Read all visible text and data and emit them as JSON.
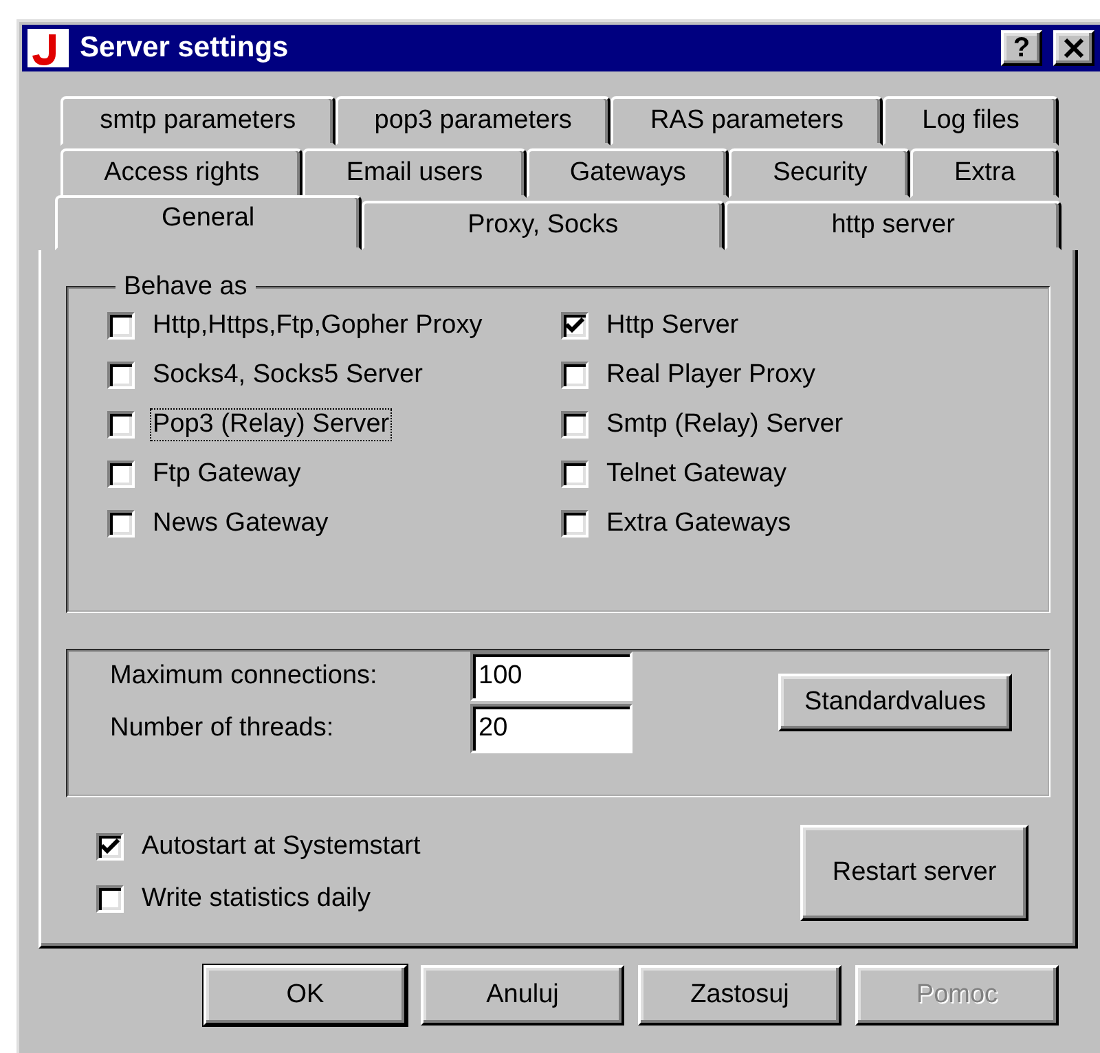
{
  "window": {
    "title": "Server settings",
    "help_button": "?"
  },
  "tab_rows": [
    [
      {
        "label": "smtp parameters",
        "selected": false
      },
      {
        "label": "pop3 parameters",
        "selected": false
      },
      {
        "label": "RAS parameters",
        "selected": false
      },
      {
        "label": "Log files",
        "selected": false
      }
    ],
    [
      {
        "label": "Access rights",
        "selected": false
      },
      {
        "label": "Email users",
        "selected": false
      },
      {
        "label": "Gateways",
        "selected": false
      },
      {
        "label": "Security",
        "selected": false
      },
      {
        "label": "Extra",
        "selected": false
      }
    ],
    [
      {
        "label": "General",
        "selected": true
      },
      {
        "label": "Proxy, Socks",
        "selected": false
      },
      {
        "label": "http server",
        "selected": false
      }
    ]
  ],
  "behave_as": {
    "title": "Behave as",
    "options": [
      {
        "label": "Http,Https,Ftp,Gopher Proxy",
        "checked": false,
        "focused": false
      },
      {
        "label": "Http Server",
        "checked": true,
        "focused": false
      },
      {
        "label": "Socks4, Socks5 Server",
        "checked": false,
        "focused": false
      },
      {
        "label": "Real Player Proxy",
        "checked": false,
        "focused": false
      },
      {
        "label": "Pop3 (Relay) Server",
        "checked": false,
        "focused": true
      },
      {
        "label": "Smtp (Relay) Server",
        "checked": false,
        "focused": false
      },
      {
        "label": "Ftp Gateway",
        "checked": false,
        "focused": false
      },
      {
        "label": "Telnet Gateway",
        "checked": false,
        "focused": false
      },
      {
        "label": "News Gateway",
        "checked": false,
        "focused": false
      },
      {
        "label": "Extra Gateways",
        "checked": false,
        "focused": false
      }
    ]
  },
  "limits": {
    "fields": [
      {
        "label": "Maximum connections:",
        "value": "100"
      },
      {
        "label": "Number of threads:",
        "value": "20"
      }
    ],
    "button": "Standardvalues"
  },
  "startup_options": [
    {
      "label": "Autostart at Systemstart",
      "checked": true
    },
    {
      "label": "Write statistics daily",
      "checked": false
    }
  ],
  "restart_button": "Restart server",
  "buttons": [
    {
      "label": "OK",
      "default": true,
      "disabled": false
    },
    {
      "label": "Anuluj",
      "default": false,
      "disabled": false
    },
    {
      "label": "Zastosuj",
      "default": false,
      "disabled": false
    },
    {
      "label": "Pomoc",
      "default": false,
      "disabled": true
    }
  ]
}
